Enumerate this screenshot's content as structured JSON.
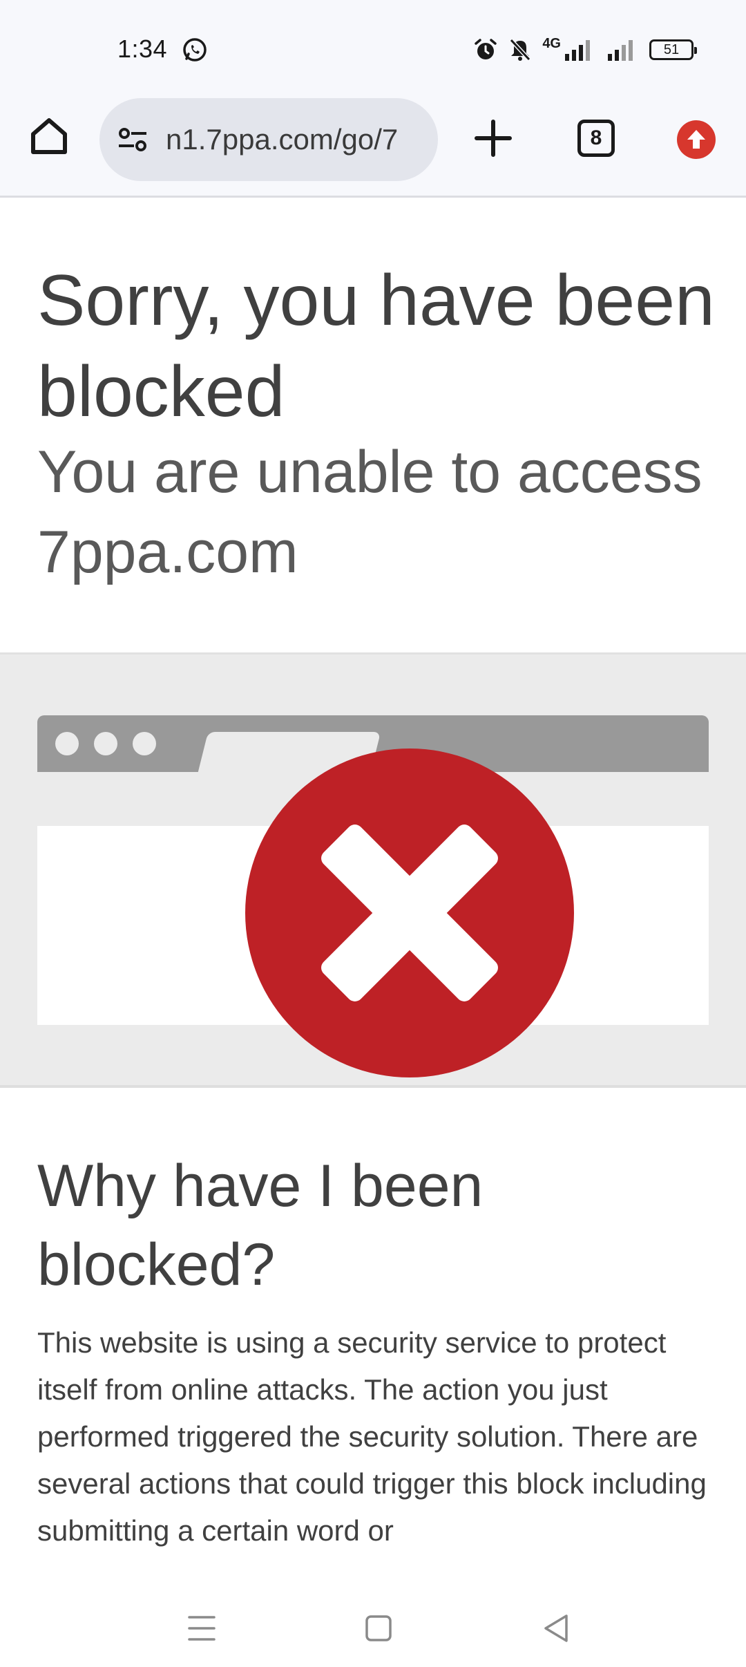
{
  "status_bar": {
    "time": "1:34",
    "network_label": "4G",
    "battery_level": "51",
    "icons": [
      "whatsapp-icon",
      "alarm-icon",
      "mute-icon",
      "signal-icon",
      "signal-icon",
      "battery-icon"
    ]
  },
  "browser": {
    "url": "n1.7ppa.com/go/7",
    "tab_count": "8",
    "accent_color": "#d7372d"
  },
  "page": {
    "title": "Sorry, you have been blocked",
    "subtitle": "You are unable to access 7ppa.com",
    "section_heading": "Why have I been blocked?",
    "section_body": "This website is using a security service to protect itself from online attacks. The action you just performed triggered the security solution. There are several actions that could trigger this block including submitting a certain word or",
    "illustration_color": "#be2126"
  },
  "nav_bar": {
    "icons": [
      "menu-icon",
      "home-square-icon",
      "back-triangle-icon"
    ]
  }
}
